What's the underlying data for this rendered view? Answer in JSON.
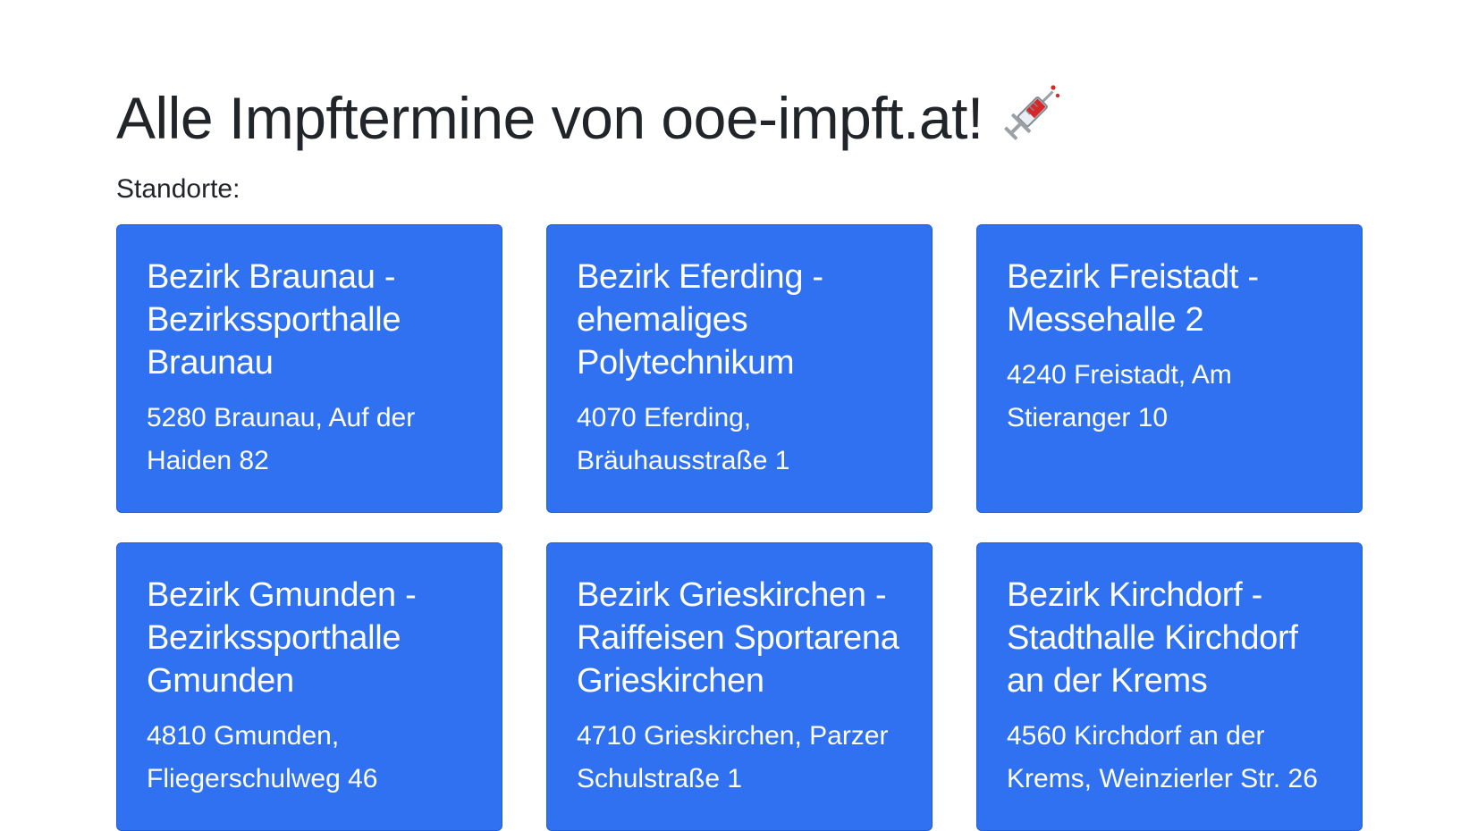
{
  "page": {
    "title": "Alle Impftermine von ooe-impft.at!",
    "title_icon": "syringe-icon",
    "section_label": "Standorte:"
  },
  "colors": {
    "card_background": "#2f71f0",
    "card_text": "#ffffff",
    "page_text": "#212529"
  },
  "locations": [
    {
      "title": "Bezirk Braunau - Bezirkssporthalle Braunau",
      "address": "5280 Braunau, Auf der Haiden 82"
    },
    {
      "title": "Bezirk Eferding - ehemaliges Polytechnikum",
      "address": "4070 Eferding, Bräuhausstraße 1"
    },
    {
      "title": "Bezirk Freistadt - Messehalle 2",
      "address": "4240 Freistadt, Am Stieranger 10"
    },
    {
      "title": "Bezirk Gmunden - Bezirkssporthalle Gmunden",
      "address": "4810 Gmunden, Fliegerschulweg 46"
    },
    {
      "title": "Bezirk Grieskirchen - Raiffeisen Sportarena Grieskirchen",
      "address": "4710 Grieskirchen, Parzer Schulstraße 1"
    },
    {
      "title": "Bezirk Kirchdorf - Stadthalle Kirchdorf an der Krems",
      "address": "4560 Kirchdorf an der Krems, Weinzierler Str. 26"
    }
  ]
}
